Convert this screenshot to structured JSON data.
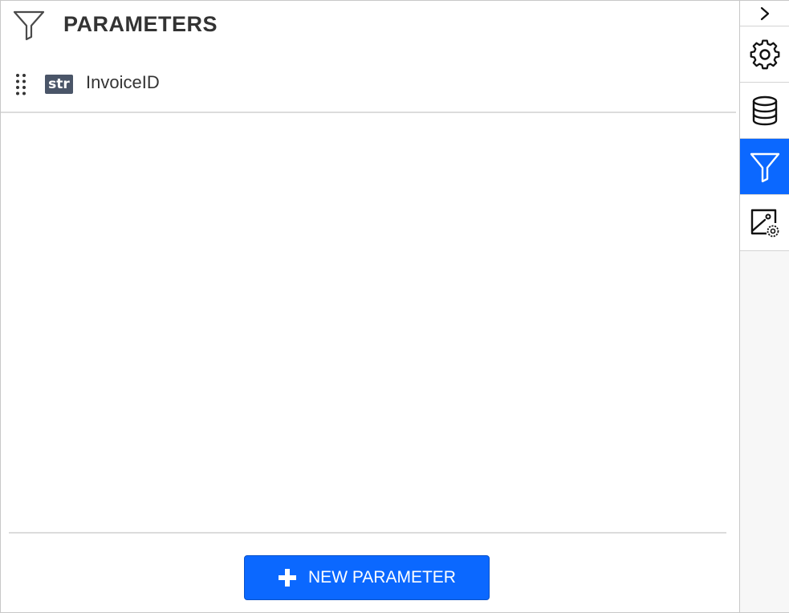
{
  "panel": {
    "title": "PARAMETERS",
    "header_icon": "filter-icon"
  },
  "parameters": [
    {
      "type_badge": "str",
      "name": "InvoiceID",
      "handle_icon": "drag-handle-icon"
    }
  ],
  "footer": {
    "new_button_label": "NEW PARAMETER",
    "new_button_icon": "plus-icon"
  },
  "sidebar": {
    "items": [
      {
        "name": "collapse",
        "icon": "chevron-right-icon",
        "active": false
      },
      {
        "name": "properties",
        "icon": "gear-icon",
        "active": false
      },
      {
        "name": "data",
        "icon": "database-icon",
        "active": false
      },
      {
        "name": "parameters",
        "icon": "filter-icon",
        "active": true
      },
      {
        "name": "image-settings",
        "icon": "image-settings-icon",
        "active": false
      }
    ]
  },
  "colors": {
    "accent": "#0b68ff",
    "badge": "#4a5568",
    "text": "#333333",
    "divider": "#dcdcdc"
  }
}
